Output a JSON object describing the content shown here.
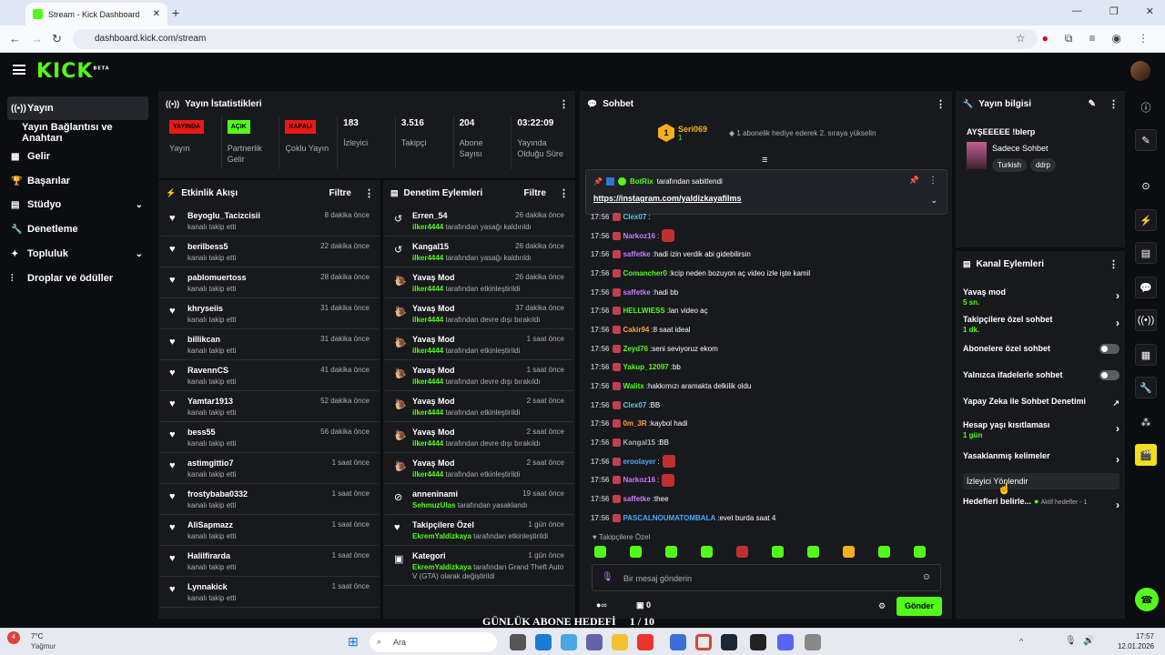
{
  "browser": {
    "tab_title": "Stream - Kick Dashboard",
    "url": "dashboard.kick.com/stream"
  },
  "logo": "KICK",
  "logo_sup": "BETA",
  "sidebar": [
    {
      "label": "Yayın",
      "icon": "stream-icon",
      "active": true
    },
    {
      "label": "Yayın Bağlantısı ve Anahtarı",
      "icon": "",
      "active": false
    },
    {
      "label": "Gelir",
      "icon": "revenue-icon",
      "active": false
    },
    {
      "label": "Başarılar",
      "icon": "trophy-icon",
      "active": false
    },
    {
      "label": "Stüdyo",
      "icon": "studio-icon",
      "active": false,
      "chevron": true
    },
    {
      "label": "Denetleme",
      "icon": "wrench-icon",
      "active": false
    },
    {
      "label": "Topluluk",
      "icon": "community-icon",
      "active": false,
      "chevron": true
    },
    {
      "label": "Droplar ve ödüller",
      "icon": "drops-icon",
      "active": false
    }
  ],
  "stats": {
    "title": "Yayın İstatistikleri",
    "items": [
      {
        "badge": "YAYINDA",
        "badge_color": "#e91916",
        "badge_text": "#000",
        "label": "Yayın"
      },
      {
        "badge": "AÇIK",
        "badge_color": "#53fc18",
        "badge_text": "#000",
        "label": "Partnerlik Gelir Programı"
      },
      {
        "badge": "KAPALI",
        "badge_color": "#e91916",
        "badge_text": "#000",
        "label": "Çoklu Yayın"
      },
      {
        "value": "183",
        "label": "İzleyici"
      },
      {
        "value": "3.516",
        "label": "Takipçi"
      },
      {
        "value": "204",
        "label": "Abone Sayısı"
      },
      {
        "value": "03:22:09",
        "label": "Yayında Olduğu Süre"
      }
    ]
  },
  "activity": {
    "title": "Etkinlik Akışı",
    "filter": "Filtre",
    "items": [
      {
        "name": "Beyoglu_Tacizcisii",
        "time": "8 dakika önce",
        "sub": "kanalı takip etti"
      },
      {
        "name": "berilbess5",
        "time": "22 dakika önce",
        "sub": "kanalı takip etti"
      },
      {
        "name": "pablomuertoss",
        "time": "28 dakika önce",
        "sub": "kanalı takip etti"
      },
      {
        "name": "khryseiis",
        "time": "31 dakika önce",
        "sub": "kanalı takip etti"
      },
      {
        "name": "billikcan",
        "time": "31 dakika önce",
        "sub": "kanalı takip etti"
      },
      {
        "name": "RavennCS",
        "time": "41 dakika önce",
        "sub": "kanalı takip etti"
      },
      {
        "name": "Yamtar1913",
        "time": "52 dakika önce",
        "sub": "kanalı takip etti"
      },
      {
        "name": "bess55",
        "time": "56 dakika önce",
        "sub": "kanalı takip etti"
      },
      {
        "name": "astimgittio7",
        "time": "1 saat önce",
        "sub": "kanalı takip etti"
      },
      {
        "name": "frostybaba0332",
        "time": "1 saat önce",
        "sub": "kanalı takip etti"
      },
      {
        "name": "AliSapmazz",
        "time": "1 saat önce",
        "sub": "kanalı takip etti"
      },
      {
        "name": "Halilfirarda",
        "time": "1 saat önce",
        "sub": "kanalı takip etti"
      },
      {
        "name": "Lynnakick",
        "time": "1 saat önce",
        "sub": "kanalı takip etti"
      }
    ]
  },
  "moderation": {
    "title": "Denetim Eylemleri",
    "filter": "Filtre",
    "items": [
      {
        "icon": "undo-icon",
        "name": "Erren_54",
        "time": "26 dakika önce",
        "actor": "ilker4444",
        "sub": "tarafından yasağı kaldırıldı"
      },
      {
        "icon": "undo-icon",
        "name": "Kangal15",
        "time": "26 dakika önce",
        "actor": "ilker4444",
        "sub": "tarafından yasağı kaldırıldı"
      },
      {
        "icon": "snail-icon",
        "name": "Yavaş Mod",
        "time": "26 dakika önce",
        "actor": "ilker4444",
        "sub": "tarafından etkinleştirildi"
      },
      {
        "icon": "snail-icon",
        "name": "Yavaş Mod",
        "time": "37 dakika önce",
        "actor": "ilker4444",
        "sub": "tarafından devre dışı bırakıldı"
      },
      {
        "icon": "snail-icon",
        "name": "Yavaş Mod",
        "time": "1 saat önce",
        "actor": "ilker4444",
        "sub": "tarafından etkinleştirildi"
      },
      {
        "icon": "snail-icon",
        "name": "Yavaş Mod",
        "time": "1 saat önce",
        "actor": "ilker4444",
        "sub": "tarafından devre dışı bırakıldı"
      },
      {
        "icon": "snail-icon",
        "name": "Yavaş Mod",
        "time": "2 saat önce",
        "actor": "ilker4444",
        "sub": "tarafından etkinleştirildi"
      },
      {
        "icon": "snail-icon",
        "name": "Yavaş Mod",
        "time": "2 saat önce",
        "actor": "ilker4444",
        "sub": "tarafından devre dışı bırakıldı"
      },
      {
        "icon": "snail-icon",
        "name": "Yavaş Mod",
        "time": "2 saat önce",
        "actor": "ilker4444",
        "sub": "tarafından etkinleştirildi"
      },
      {
        "icon": "ban-icon",
        "name": "anneninami",
        "time": "19 saat önce",
        "actor": "SehmuzUlas",
        "sub": "tarafından yasaklandı"
      },
      {
        "icon": "heart-icon",
        "name": "Takipçilere Özel",
        "time": "1 gün önce",
        "actor": "EkremYaldizkaya",
        "sub": "tarafından etkinleştirildi"
      },
      {
        "icon": "category-icon",
        "name": "Kategori",
        "time": "1 gün önce",
        "actor": "EkremYaldizkaya",
        "sub": "tarafından Grand Theft Auto V (GTA) olarak değiştirildi"
      }
    ]
  },
  "chat": {
    "title": "Sohbet",
    "top_gifter": "Seri069",
    "top_gifter_count": "1",
    "gift_text": "1 abonelik hediye ederek 2. sıraya yükselin",
    "pinned_by": "BotRix",
    "pinned_label": "tarafından sabitlendi",
    "pinned_link": "https://instagram.com/yaldizkayafilms",
    "messages": [
      {
        "time": "17:56",
        "user": "Clex07",
        "color": "#4dd0e1",
        "text": ""
      },
      {
        "time": "17:56",
        "user": "Narkoz16",
        "color": "#c77dff",
        "text": "",
        "emote": true
      },
      {
        "time": "17:56",
        "user": "saffetke",
        "color": "#c77dff",
        "text": "hadi izin verdik abi gidebilirsin"
      },
      {
        "time": "17:56",
        "user": "Comancher0",
        "color": "#53fc18",
        "text": "kcip neden bozuyon aç video izle işte kamil"
      },
      {
        "time": "17:56",
        "user": "saffetke",
        "color": "#c77dff",
        "text": "hadi bb"
      },
      {
        "time": "17:56",
        "user": "HELLWIESS",
        "color": "#53fc18",
        "text": "lan video aç"
      },
      {
        "time": "17:56",
        "user": "Cakir94",
        "color": "#ff9f43",
        "text": "8 saat ideal"
      },
      {
        "time": "17:56",
        "user": "Zeyd76",
        "color": "#53fc18",
        "text": "seni seviyoruz ekom"
      },
      {
        "time": "17:56",
        "user": "Yakup_12097",
        "color": "#53fc18",
        "text": "bb"
      },
      {
        "time": "17:56",
        "user": "Walitx",
        "color": "#53fc18",
        "text": "hakkımızı aramakta delkilik oldu"
      },
      {
        "time": "17:56",
        "user": "Clex07",
        "color": "#4dd0e1",
        "text": "BB"
      },
      {
        "time": "17:56",
        "user": "0m_3R",
        "color": "#ff9f43",
        "text": "kaybol hadi"
      },
      {
        "time": "17:56",
        "user": "Kangal15",
        "color": "#adadb8",
        "text": "BB"
      },
      {
        "time": "17:56",
        "user": "eroolayer",
        "color": "#4dabf7",
        "text": "",
        "emote": true
      },
      {
        "time": "17:56",
        "user": "Narkoz16",
        "color": "#c77dff",
        "text": "",
        "emote": true
      },
      {
        "time": "17:56",
        "user": "saffetke",
        "color": "#c77dff",
        "text": "thee"
      },
      {
        "time": "17:56",
        "user": "PASCALNOUMATOMBALA",
        "color": "#4dabf7",
        "text": "evet burda saat 4"
      }
    ],
    "followers_only": "Takipçilere Özel",
    "input_placeholder": "Bir mesaj gönderin",
    "points": "0",
    "send": "Gönder"
  },
  "stream_info": {
    "title": "Yayın bilgisi",
    "stream_title": "AYŞEEEEE !blerp",
    "category": "Sadece Sohbet",
    "tags": [
      "Turkish",
      "ddrp"
    ]
  },
  "channel_actions": {
    "title": "Kanal Eylemleri",
    "items": [
      {
        "label": "Yavaş mod",
        "sub": "5 sn.",
        "type": "arrow"
      },
      {
        "label": "Takipçilere özel sohbet",
        "sub": "1 dk.",
        "type": "arrow"
      },
      {
        "label": "Abonelere özel sohbet",
        "sub": "",
        "type": "toggle"
      },
      {
        "label": "Yalnızca ifadelerle sohbet",
        "sub": "",
        "type": "toggle"
      },
      {
        "label": "Yapay Zeka ile Sohbet Denetimi",
        "sub": "",
        "type": "external"
      },
      {
        "label": "Hesap yaşı kısıtlaması",
        "sub": "1 gün",
        "type": "arrow"
      },
      {
        "label": "Yasaklanmış kelimeler",
        "sub": "",
        "type": "arrow"
      },
      {
        "label": "İzleyici Yönlendir",
        "sub": "",
        "type": "none"
      },
      {
        "label": "Hedefleri belirle...",
        "sub": "",
        "type": "arrow",
        "extra": "Aktif hedefler - 1"
      }
    ]
  },
  "overlay": {
    "goal_text": "GÜNLÜK ABONE HEDEFİ",
    "goal_progress": "1 / 10"
  },
  "taskbar": {
    "weather_temp": "7°C",
    "weather_label": "Yağmur",
    "search": "Ara",
    "time": "17:57",
    "date": "12.01.2026"
  }
}
